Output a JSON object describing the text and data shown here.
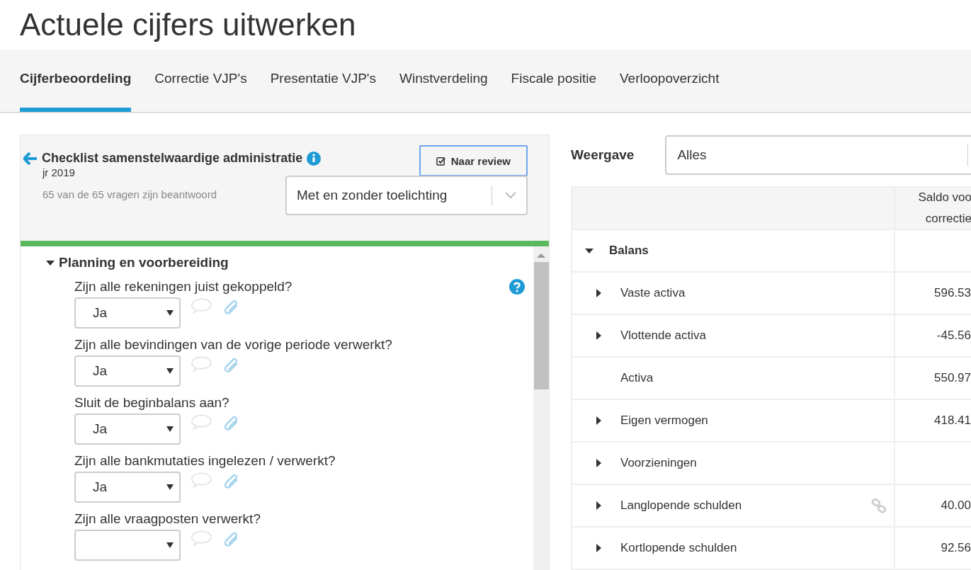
{
  "page_title": "Actuele cijfers uitwerken",
  "tabs": [
    {
      "label": "Cijferbeoordeling",
      "selected": true
    },
    {
      "label": "Correctie VJP's",
      "selected": false
    },
    {
      "label": "Presentatie VJP's",
      "selected": false
    },
    {
      "label": "Winstverdeling",
      "selected": false
    },
    {
      "label": "Fiscale positie",
      "selected": false
    },
    {
      "label": "Verloopoverzicht",
      "selected": false
    }
  ],
  "checklist": {
    "title": "Checklist samenstelwaardige administratie",
    "year": "jr 2019",
    "progress_text": "65 van de 65 vragen zijn beantwoord",
    "review_button": "Naar review",
    "filter": {
      "value": "Met en zonder toelichting"
    },
    "progress": {
      "level": 1
    },
    "section": {
      "title": "Planning en voorbereiding",
      "expanded": true,
      "questions": [
        {
          "text": "Zijn alle rekeningen juist gekoppeld?",
          "answer": "Ja",
          "help": true
        },
        {
          "text": "Zijn alle bevindingen van de vorige periode verwerkt?",
          "answer": "Ja",
          "help": false
        },
        {
          "text": "Sluit de beginbalans aan?",
          "answer": "Ja",
          "help": false
        },
        {
          "text": "Zijn alle bankmutaties ingelezen / verwerkt?",
          "answer": "Ja",
          "help": false
        },
        {
          "text": "Zijn alle vraagposten verwerkt?",
          "help": false
        }
      ]
    }
  },
  "view": {
    "label": "Weergave",
    "value": "Alles"
  },
  "table": {
    "column_2": "Saldo voo correctie",
    "rows": [
      {
        "label": "Balans",
        "expanded": true,
        "children": [
          {
            "label": "Vaste activa",
            "value": "596.53",
            "expanded": false,
            "linked": false
          },
          {
            "label": "Vlottende activa",
            "value": "-45.56",
            "expanded": false,
            "linked": false
          },
          {
            "label": "Activa",
            "value": "550.97",
            "linked": false
          },
          {
            "label": "Eigen vermogen",
            "value": "418.41",
            "expanded": false,
            "linked": false
          },
          {
            "label": "Voorzieningen",
            "expanded": false,
            "linked": false
          },
          {
            "label": "Langlopende schulden",
            "value": "40.00",
            "expanded": false,
            "linked": true
          },
          {
            "label": "Kortlopende schulden",
            "value": "92.56",
            "expanded": false,
            "linked": false
          }
        ]
      }
    ]
  }
}
